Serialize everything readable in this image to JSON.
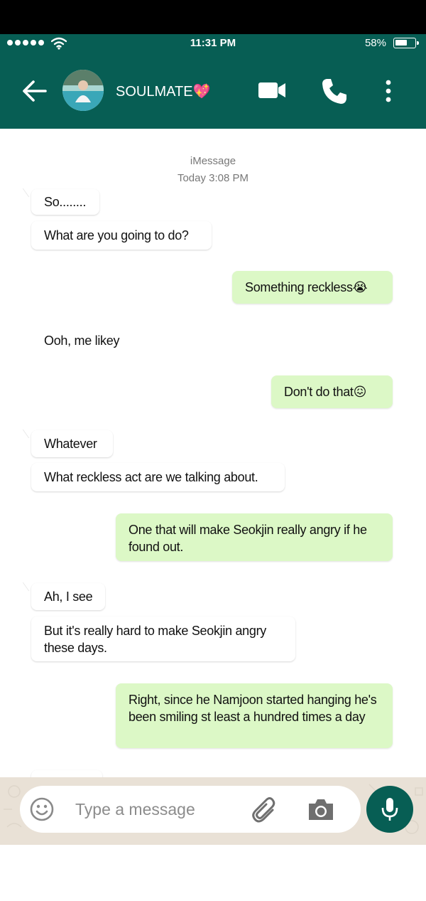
{
  "status_bar": {
    "time": "11:31 PM",
    "battery_percent": "58%",
    "battery_level": 0.58,
    "signal_bars": 5
  },
  "header": {
    "contact_name": "SOULMATE💖",
    "icons": [
      "back-arrow-icon",
      "video-call-icon",
      "phone-icon",
      "more-vertical-icon"
    ]
  },
  "chat": {
    "service_label": "iMessage",
    "timestamp": "Today 3:08 PM",
    "messages": [
      {
        "side": "in",
        "text": "So........"
      },
      {
        "side": "in",
        "text": "What are you going to do?"
      },
      {
        "side": "out",
        "text": "Something reckless😭"
      },
      {
        "side": "in",
        "text": "Ooh, me likey"
      },
      {
        "side": "out",
        "text": "Don't do that😖"
      },
      {
        "side": "in",
        "text": "Whatever"
      },
      {
        "side": "in",
        "text": "What reckless act are we talking about."
      },
      {
        "side": "out",
        "text": "One that will make Seokjin really angry if he found out."
      },
      {
        "side": "in",
        "text": "Ah, I see"
      },
      {
        "side": "in",
        "text": "But it's really hard to make Seokjin angry these days."
      },
      {
        "side": "out",
        "text": "Right, since he Namjoon started hanging he's been smiling st least a hundred times a day"
      }
    ]
  },
  "composer": {
    "placeholder": "Type a message",
    "icons": [
      "emoji-icon",
      "attach-clip-icon",
      "camera-icon",
      "mic-icon"
    ]
  },
  "colors": {
    "header_bg": "#075e54",
    "outgoing_bubble": "#dcf8c6",
    "incoming_bubble": "#ffffff",
    "composer_bg": "#e9e1d6"
  }
}
